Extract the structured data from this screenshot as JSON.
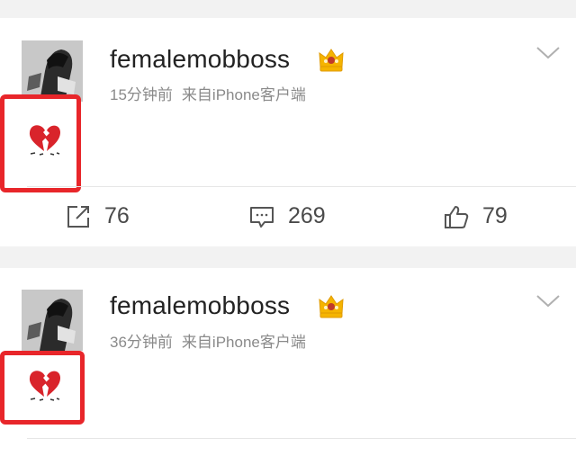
{
  "posts": [
    {
      "username": "femalemobboss",
      "time": "15分钟前",
      "source": "来自iPhone客户端",
      "content_emoji": "broken-heart",
      "reposts": "76",
      "comments": "269",
      "likes": "79"
    },
    {
      "username": "femalemobboss",
      "time": "36分钟前",
      "source": "来自iPhone客户端",
      "content_emoji": "broken-heart"
    }
  ],
  "colors": {
    "highlight_box": "#e8262a",
    "crown": "#f5b400",
    "heart": "#d9242b",
    "meta_text": "#8a8a8a",
    "background": "#f2f2f2"
  }
}
